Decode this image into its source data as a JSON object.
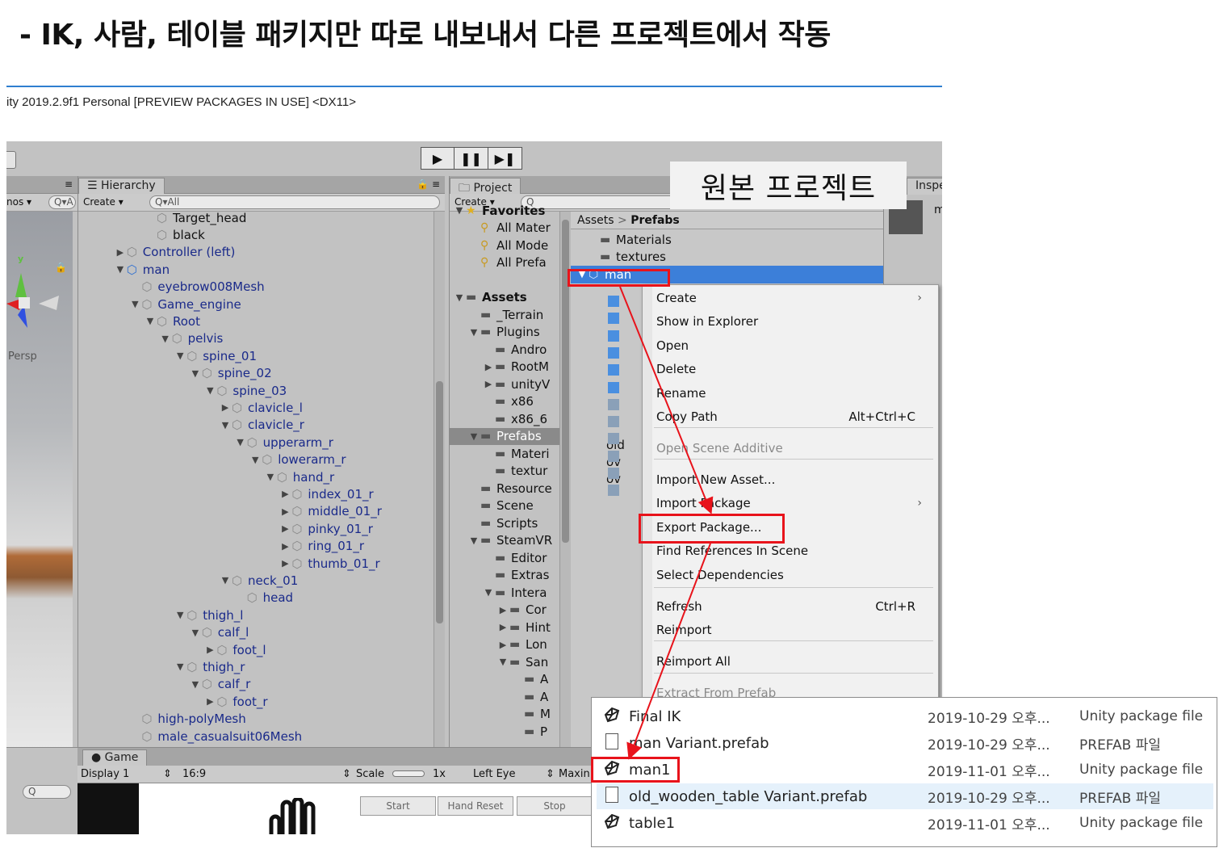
{
  "slide": {
    "title": "- IK, 사람, 테이블 패키지만 따로 내보내서 다른 프로젝트에서 작동",
    "window_title": "ity 2019.2.9f1 Personal [PREVIEW PACKAGES IN USE] <DX11>",
    "callout": "원본 프로젝트"
  },
  "toolbar": {
    "play_icon": "▶",
    "pause_icon": "❚❚",
    "step_icon": "▶❚"
  },
  "scene": {
    "tab_stub": "≡",
    "gizmos_label": "nos ▾",
    "search_label": "Q▾A",
    "persp_label": "Persp",
    "y_axis": "y"
  },
  "hierarchy": {
    "tab_label": "☰ Hierarchy",
    "create_label": "Create ▾",
    "search_placeholder": "Q▾All",
    "rows": [
      {
        "label": "Target_head",
        "depth": 5,
        "arrow": "",
        "icon": "cube",
        "color": "black"
      },
      {
        "label": "black",
        "depth": 5,
        "arrow": "",
        "icon": "cube",
        "color": "black"
      },
      {
        "label": "Controller (left)",
        "depth": 3,
        "arrow": "▶",
        "icon": "cube",
        "color": "blue"
      },
      {
        "label": "man",
        "depth": 3,
        "arrow": "▼",
        "icon": "prefab",
        "color": "blue"
      },
      {
        "label": "eyebrow008Mesh",
        "depth": 4,
        "arrow": "",
        "icon": "cube",
        "color": "blue"
      },
      {
        "label": "Game_engine",
        "depth": 4,
        "arrow": "▼",
        "icon": "cube",
        "color": "blue"
      },
      {
        "label": "Root",
        "depth": 5,
        "arrow": "▼",
        "icon": "cube",
        "color": "blue"
      },
      {
        "label": "pelvis",
        "depth": 6,
        "arrow": "▼",
        "icon": "cube",
        "color": "blue"
      },
      {
        "label": "spine_01",
        "depth": 7,
        "arrow": "▼",
        "icon": "cube",
        "color": "blue"
      },
      {
        "label": "spine_02",
        "depth": 8,
        "arrow": "▼",
        "icon": "cube",
        "color": "blue"
      },
      {
        "label": "spine_03",
        "depth": 9,
        "arrow": "▼",
        "icon": "cube",
        "color": "blue"
      },
      {
        "label": "clavicle_l",
        "depth": 10,
        "arrow": "▶",
        "icon": "cube",
        "color": "blue"
      },
      {
        "label": "clavicle_r",
        "depth": 10,
        "arrow": "▼",
        "icon": "cube",
        "color": "blue"
      },
      {
        "label": "upperarm_r",
        "depth": 11,
        "arrow": "▼",
        "icon": "cube",
        "color": "blue"
      },
      {
        "label": "lowerarm_r",
        "depth": 12,
        "arrow": "▼",
        "icon": "cube",
        "color": "blue"
      },
      {
        "label": "hand_r",
        "depth": 13,
        "arrow": "▼",
        "icon": "cube",
        "color": "blue"
      },
      {
        "label": "index_01_r",
        "depth": 14,
        "arrow": "▶",
        "icon": "cube",
        "color": "blue"
      },
      {
        "label": "middle_01_r",
        "depth": 14,
        "arrow": "▶",
        "icon": "cube",
        "color": "blue"
      },
      {
        "label": "pinky_01_r",
        "depth": 14,
        "arrow": "▶",
        "icon": "cube",
        "color": "blue"
      },
      {
        "label": "ring_01_r",
        "depth": 14,
        "arrow": "▶",
        "icon": "cube",
        "color": "blue"
      },
      {
        "label": "thumb_01_r",
        "depth": 14,
        "arrow": "▶",
        "icon": "cube",
        "color": "blue"
      },
      {
        "label": "neck_01",
        "depth": 10,
        "arrow": "▼",
        "icon": "cube",
        "color": "blue"
      },
      {
        "label": "head",
        "depth": 11,
        "arrow": "",
        "icon": "cube",
        "color": "blue"
      },
      {
        "label": "thigh_l",
        "depth": 7,
        "arrow": "▼",
        "icon": "cube",
        "color": "blue"
      },
      {
        "label": "calf_l",
        "depth": 8,
        "arrow": "▼",
        "icon": "cube",
        "color": "blue"
      },
      {
        "label": "foot_l",
        "depth": 9,
        "arrow": "▶",
        "icon": "cube",
        "color": "blue"
      },
      {
        "label": "thigh_r",
        "depth": 7,
        "arrow": "▼",
        "icon": "cube",
        "color": "blue"
      },
      {
        "label": "calf_r",
        "depth": 8,
        "arrow": "▼",
        "icon": "cube",
        "color": "blue"
      },
      {
        "label": "foot_r",
        "depth": 9,
        "arrow": "▶",
        "icon": "cube",
        "color": "blue"
      },
      {
        "label": "high-polyMesh",
        "depth": 4,
        "arrow": "",
        "icon": "cube",
        "color": "blue"
      },
      {
        "label": "male_casualsuit06Mesh",
        "depth": 4,
        "arrow": "",
        "icon": "cube",
        "color": "blue"
      }
    ]
  },
  "project": {
    "tab_label": "Project",
    "create_label": "Create ▾",
    "search_placeholder": "Q",
    "breadcrumb_root": "Assets",
    "breadcrumb_sep": ">",
    "breadcrumb_current": "Prefabs",
    "tree": [
      {
        "label": "Favorites",
        "indent": 0,
        "arrow": "▼",
        "icon": "star",
        "bold": true,
        "sel": false
      },
      {
        "label": "All Mater",
        "indent": 1,
        "arrow": "",
        "icon": "search",
        "bold": false,
        "sel": false
      },
      {
        "label": "All Mode",
        "indent": 1,
        "arrow": "",
        "icon": "search",
        "bold": false,
        "sel": false
      },
      {
        "label": "All Prefa",
        "indent": 1,
        "arrow": "",
        "icon": "search",
        "bold": false,
        "sel": false
      },
      {
        "label": "",
        "indent": 0,
        "arrow": "",
        "icon": "",
        "bold": false,
        "sel": false
      },
      {
        "label": "Assets",
        "indent": 0,
        "arrow": "▼",
        "icon": "folder",
        "bold": true,
        "sel": false
      },
      {
        "label": "_Terrain",
        "indent": 1,
        "arrow": "",
        "icon": "folder",
        "bold": false,
        "sel": false
      },
      {
        "label": "Plugins",
        "indent": 1,
        "arrow": "▼",
        "icon": "folder",
        "bold": false,
        "sel": false
      },
      {
        "label": "Andro",
        "indent": 2,
        "arrow": "",
        "icon": "folder",
        "bold": false,
        "sel": false
      },
      {
        "label": "RootM",
        "indent": 2,
        "arrow": "▶",
        "icon": "folder",
        "bold": false,
        "sel": false
      },
      {
        "label": "unityV",
        "indent": 2,
        "arrow": "▶",
        "icon": "folder",
        "bold": false,
        "sel": false
      },
      {
        "label": "x86",
        "indent": 2,
        "arrow": "",
        "icon": "folder",
        "bold": false,
        "sel": false
      },
      {
        "label": "x86_6",
        "indent": 2,
        "arrow": "",
        "icon": "folder",
        "bold": false,
        "sel": false
      },
      {
        "label": "Prefabs",
        "indent": 1,
        "arrow": "▼",
        "icon": "folder",
        "bold": false,
        "sel": true
      },
      {
        "label": "Materi",
        "indent": 2,
        "arrow": "",
        "icon": "folder",
        "bold": false,
        "sel": false
      },
      {
        "label": "textur",
        "indent": 2,
        "arrow": "",
        "icon": "folder",
        "bold": false,
        "sel": false
      },
      {
        "label": "Resource",
        "indent": 1,
        "arrow": "",
        "icon": "folder",
        "bold": false,
        "sel": false
      },
      {
        "label": "Scene",
        "indent": 1,
        "arrow": "",
        "icon": "folder",
        "bold": false,
        "sel": false
      },
      {
        "label": "Scripts",
        "indent": 1,
        "arrow": "",
        "icon": "folder",
        "bold": false,
        "sel": false
      },
      {
        "label": "SteamVR",
        "indent": 1,
        "arrow": "▼",
        "icon": "folder",
        "bold": false,
        "sel": false
      },
      {
        "label": "Editor",
        "indent": 2,
        "arrow": "",
        "icon": "folder",
        "bold": false,
        "sel": false
      },
      {
        "label": "Extras",
        "indent": 2,
        "arrow": "",
        "icon": "folder",
        "bold": false,
        "sel": false
      },
      {
        "label": "Intera",
        "indent": 2,
        "arrow": "▼",
        "icon": "folder",
        "bold": false,
        "sel": false
      },
      {
        "label": "Cor",
        "indent": 3,
        "arrow": "▶",
        "icon": "folder",
        "bold": false,
        "sel": false
      },
      {
        "label": "Hint",
        "indent": 3,
        "arrow": "▶",
        "icon": "folder",
        "bold": false,
        "sel": false
      },
      {
        "label": "Lon",
        "indent": 3,
        "arrow": "▶",
        "icon": "folder",
        "bold": false,
        "sel": false
      },
      {
        "label": "San",
        "indent": 3,
        "arrow": "▼",
        "icon": "folder",
        "bold": false,
        "sel": false
      },
      {
        "label": "A",
        "indent": 4,
        "arrow": "",
        "icon": "folder",
        "bold": false,
        "sel": false
      },
      {
        "label": "A",
        "indent": 4,
        "arrow": "",
        "icon": "folder",
        "bold": false,
        "sel": false
      },
      {
        "label": "M",
        "indent": 4,
        "arrow": "",
        "icon": "folder",
        "bold": false,
        "sel": false
      },
      {
        "label": "P",
        "indent": 4,
        "arrow": "",
        "icon": "folder",
        "bold": false,
        "sel": false
      }
    ],
    "assets": [
      {
        "label": "Materials",
        "icon": "folder"
      },
      {
        "label": "textures",
        "icon": "folder"
      },
      {
        "label": "man",
        "icon": "prefab"
      }
    ],
    "asset_side_labels": [
      "old",
      "ov",
      "ov"
    ]
  },
  "inspector": {
    "tab_label": "Inspe",
    "name_stub": "m"
  },
  "context_menu": {
    "items": [
      {
        "label": "Create",
        "shortcut": "",
        "submenu": true,
        "disabled": false
      },
      {
        "label": "Show in Explorer",
        "shortcut": "",
        "submenu": false,
        "disabled": false
      },
      {
        "label": "Open",
        "shortcut": "",
        "submenu": false,
        "disabled": false
      },
      {
        "label": "Delete",
        "shortcut": "",
        "submenu": false,
        "disabled": false
      },
      {
        "label": "Rename",
        "shortcut": "",
        "submenu": false,
        "disabled": false
      },
      {
        "label": "Copy Path",
        "shortcut": "Alt+Ctrl+C",
        "submenu": false,
        "disabled": false
      },
      {
        "label": "Open Scene Additive",
        "shortcut": "",
        "submenu": false,
        "disabled": true
      },
      {
        "label": "Import New Asset...",
        "shortcut": "",
        "submenu": false,
        "disabled": false
      },
      {
        "label": "Import Package",
        "shortcut": "",
        "submenu": true,
        "disabled": false
      },
      {
        "label": "Export Package...",
        "shortcut": "",
        "submenu": false,
        "disabled": false
      },
      {
        "label": "Find References In Scene",
        "shortcut": "",
        "submenu": false,
        "disabled": false
      },
      {
        "label": "Select Dependencies",
        "shortcut": "",
        "submenu": false,
        "disabled": false
      },
      {
        "label": "Refresh",
        "shortcut": "Ctrl+R",
        "submenu": false,
        "disabled": false
      },
      {
        "label": "Reimport",
        "shortcut": "",
        "submenu": false,
        "disabled": false
      },
      {
        "label": "Reimport All",
        "shortcut": "",
        "submenu": false,
        "disabled": false
      },
      {
        "label": "Extract From Prefab",
        "shortcut": "",
        "submenu": false,
        "disabled": true
      }
    ],
    "submenu_glyph": "›"
  },
  "game": {
    "tab_label": "Game",
    "display": "Display 1",
    "aspect": "16:9",
    "scale_label": "Scale",
    "scale_value": "1x",
    "eye": "Left Eye",
    "maximize": "Maxin",
    "buttons": [
      "Start",
      "Hand Reset",
      "Stop"
    ]
  },
  "explorer": {
    "files": [
      {
        "name": "Final IK",
        "date": "2019-10-29 오후...",
        "type": "Unity package file",
        "icon": "unity"
      },
      {
        "name": "man Variant.prefab",
        "date": "2019-10-29 오후...",
        "type": "PREFAB 파일",
        "icon": "doc"
      },
      {
        "name": "man1",
        "date": "2019-11-01 오후...",
        "type": "Unity package file",
        "icon": "unity"
      },
      {
        "name": "old_wooden_table Variant.prefab",
        "date": "2019-10-29 오후...",
        "type": "PREFAB 파일",
        "icon": "doc"
      },
      {
        "name": "table1",
        "date": "2019-11-01 오후...",
        "type": "Unity package file",
        "icon": "unity"
      }
    ]
  },
  "colors": {
    "accent_line": "#2f7fd0",
    "highlight_red": "#e8131b",
    "selection_blue": "#3c7fd9",
    "hierarchy_text": "#1a2a8a"
  }
}
